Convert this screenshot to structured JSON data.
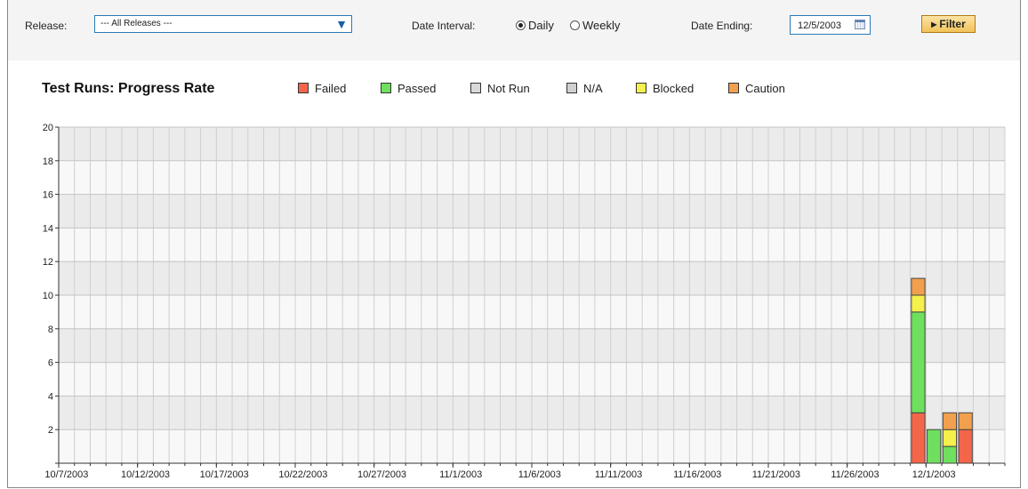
{
  "filters": {
    "release_label": "Release:",
    "release_value": "--- All Releases ---",
    "date_interval_label": "Date Interval:",
    "options": [
      {
        "label": "Daily",
        "selected": true
      },
      {
        "label": "Weekly",
        "selected": false
      }
    ],
    "date_ending_label": "Date Ending:",
    "date_ending_value": "12/5/2003",
    "filter_button": "Filter"
  },
  "chart": {
    "title": "Test Runs: Progress Rate"
  },
  "legend": [
    {
      "label": "Failed",
      "color": "#f4664a"
    },
    {
      "label": "Passed",
      "color": "#6fe05e"
    },
    {
      "label": "Not Run",
      "color": "#d9d9d9"
    },
    {
      "label": "N/A",
      "color": "#d0d0d0"
    },
    {
      "label": "Blocked",
      "color": "#f5f04c"
    },
    {
      "label": "Caution",
      "color": "#f2a04e"
    }
  ],
  "chart_data": {
    "type": "bar",
    "stacked": true,
    "title": "Test Runs: Progress Rate",
    "ylim": [
      0,
      20
    ],
    "y_ticks": [
      2,
      4,
      6,
      8,
      10,
      12,
      14,
      16,
      18,
      20
    ],
    "categories": [
      "10/7/2003",
      "10/12/2003",
      "10/17/2003",
      "10/22/2003",
      "10/27/2003",
      "11/1/2003",
      "11/6/2003",
      "11/11/2003",
      "11/16/2003",
      "11/21/2003",
      "11/26/2003",
      "12/1/2003"
    ],
    "x_start": "10/7/2003",
    "x_end": "12/5/2003",
    "series_order": [
      "Failed",
      "Passed",
      "Not Run",
      "N/A",
      "Blocked",
      "Caution"
    ],
    "bars": [
      {
        "date": "11/30/2003",
        "values": {
          "Failed": 3,
          "Passed": 6,
          "Not Run": 0,
          "N/A": 0,
          "Blocked": 1,
          "Caution": 1
        }
      },
      {
        "date": "12/1/2003",
        "values": {
          "Failed": 0,
          "Passed": 2,
          "Not Run": 0,
          "N/A": 0,
          "Blocked": 0,
          "Caution": 0
        }
      },
      {
        "date": "12/2/2003",
        "values": {
          "Failed": 0,
          "Passed": 1,
          "Not Run": 0,
          "N/A": 0,
          "Blocked": 1,
          "Caution": 1
        }
      },
      {
        "date": "12/3/2003",
        "values": {
          "Failed": 2,
          "Passed": 0,
          "Not Run": 0,
          "N/A": 0,
          "Blocked": 0,
          "Caution": 1
        }
      }
    ],
    "colors": {
      "Failed": "#f4664a",
      "Passed": "#6fe05e",
      "Not Run": "#d9d9d9",
      "N/A": "#d0d0d0",
      "Blocked": "#f5f04c",
      "Caution": "#f2a04e"
    },
    "grid": true
  }
}
